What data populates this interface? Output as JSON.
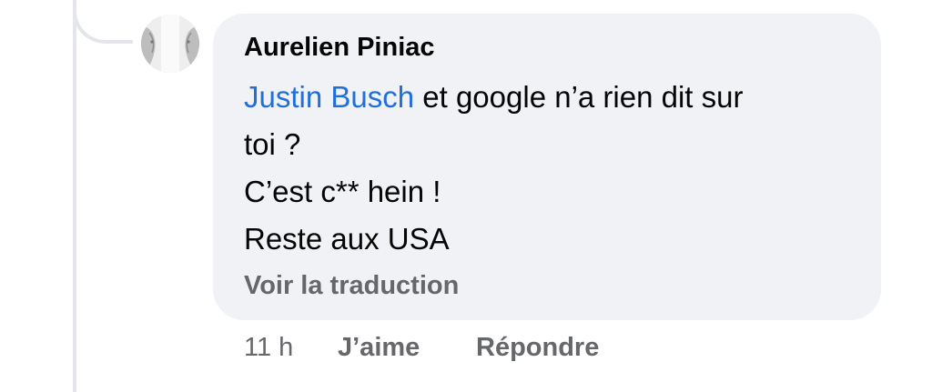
{
  "comment": {
    "author": "Aurelien Piniac",
    "mention": "Justin Busch",
    "line1_text": " et google n’a rien dit sur",
    "line2": "toi ?",
    "line3": "C’est c** hein !",
    "line4": "Reste aux USA",
    "translate_label": "Voir la traduction",
    "timestamp": "11 h",
    "like_label": "J’aime",
    "reply_label": "Répondre"
  },
  "colors": {
    "bubble_bg": "#f0f2f5",
    "mention": "#216fdb",
    "secondary_text": "#65676b",
    "thread_line": "#e4e6eb"
  },
  "icons": {
    "avatar": "profile-photo"
  }
}
